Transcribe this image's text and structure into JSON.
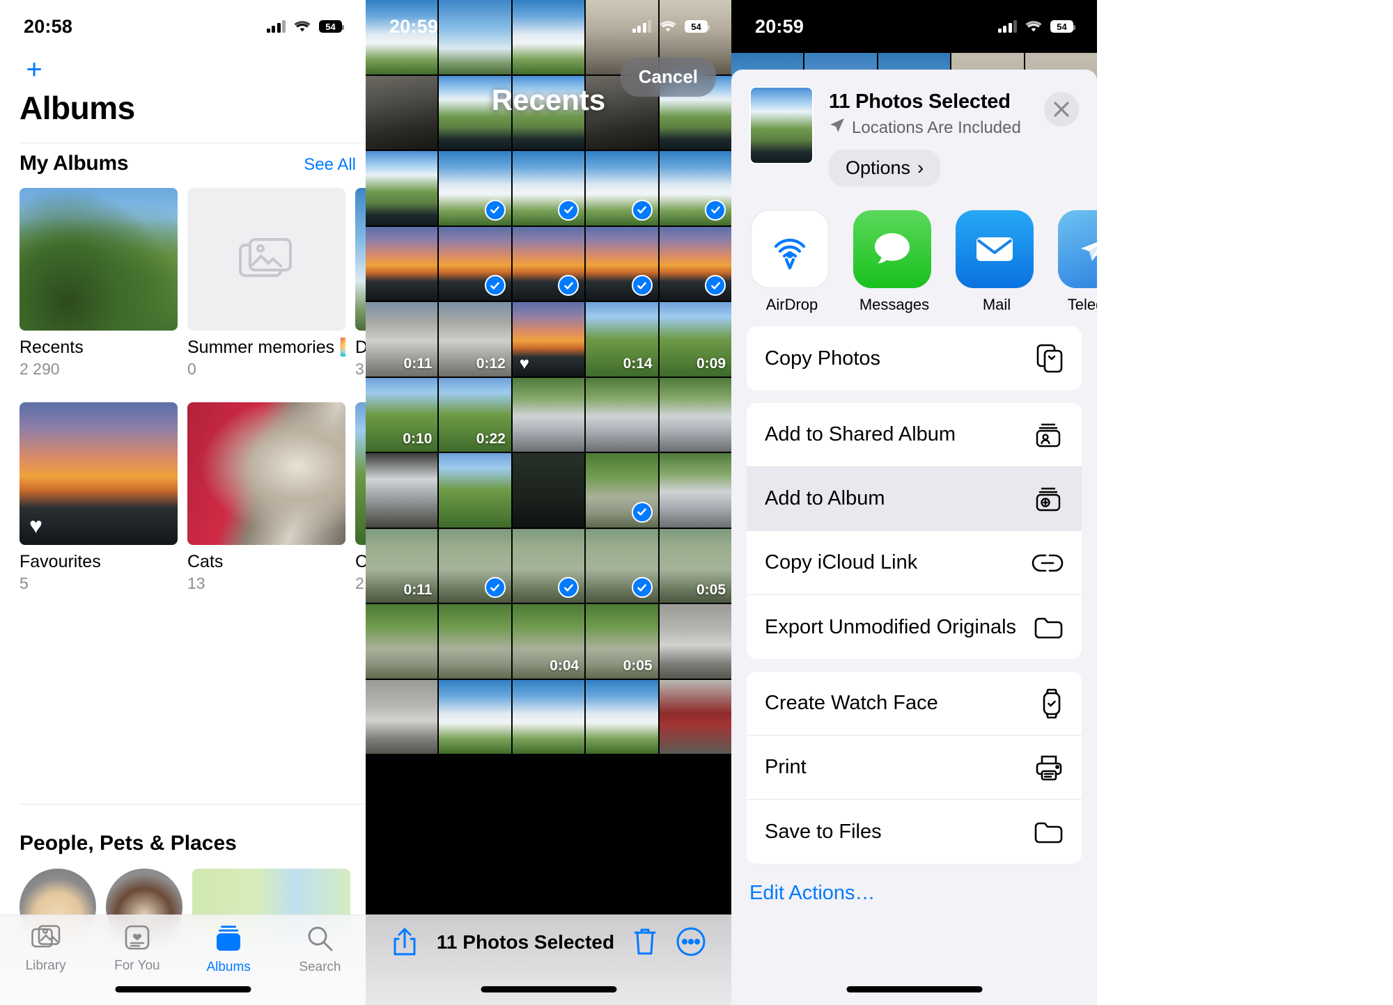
{
  "panel_albums": {
    "status": {
      "time": "20:58",
      "battery": "54"
    },
    "add_button": "+",
    "title": "Albums",
    "section": {
      "heading": "My Albums",
      "see_all": "See All"
    },
    "albums": [
      {
        "name": "Recents",
        "count": "2 290",
        "art": "img-trees",
        "favourite": false
      },
      {
        "name": "Summer memories 🌅",
        "count": "0",
        "art": "placeholder",
        "favourite": false
      },
      {
        "name": "D",
        "count": "3",
        "art": "img-sky",
        "favourite": false
      },
      {
        "name": "Favourites",
        "count": "5",
        "art": "img-sunset",
        "favourite": true
      },
      {
        "name": "Cats",
        "count": "13",
        "art": "img-cat",
        "favourite": false
      },
      {
        "name": "C",
        "count": "2",
        "art": "img-green",
        "favourite": false
      }
    ],
    "people_heading": "People, Pets & Places",
    "tabs": [
      {
        "label": "Library",
        "icon": "photos-library-icon",
        "active": false
      },
      {
        "label": "For You",
        "icon": "for-you-icon",
        "active": false
      },
      {
        "label": "Albums",
        "icon": "albums-icon",
        "active": true
      },
      {
        "label": "Search",
        "icon": "search-icon",
        "active": false
      }
    ]
  },
  "panel_recents": {
    "status": {
      "time": "20:59",
      "battery": "54"
    },
    "title": "Recents",
    "cancel": "Cancel",
    "toolbar": {
      "share_icon": "share-icon",
      "count_label": "11 Photos Selected",
      "trash_icon": "trash-icon",
      "more_icon": "more-circle-icon"
    },
    "grid": [
      {
        "art": "img-clouds",
        "dur": "",
        "sel": false,
        "fav": false
      },
      {
        "art": "img-sky",
        "dur": "",
        "sel": false,
        "fav": false
      },
      {
        "art": "img-clouds",
        "dur": "",
        "sel": false,
        "fav": false
      },
      {
        "art": "img-store",
        "dur": "",
        "sel": false,
        "fav": false
      },
      {
        "art": "img-store",
        "dur": "",
        "sel": false,
        "fav": false
      },
      {
        "art": "img-interior",
        "dur": "",
        "sel": false,
        "fav": false
      },
      {
        "art": "img-road",
        "dur": "",
        "sel": false,
        "fav": false
      },
      {
        "art": "img-road",
        "dur": "",
        "sel": false,
        "fav": false
      },
      {
        "art": "img-interior",
        "dur": "",
        "sel": false,
        "fav": false
      },
      {
        "art": "img-road",
        "dur": "",
        "sel": false,
        "fav": false
      },
      {
        "art": "img-road",
        "dur": "",
        "sel": false,
        "fav": false
      },
      {
        "art": "img-clouds",
        "dur": "",
        "sel": true,
        "fav": false
      },
      {
        "art": "img-clouds",
        "dur": "",
        "sel": true,
        "fav": false
      },
      {
        "art": "img-clouds",
        "dur": "",
        "sel": true,
        "fav": false
      },
      {
        "art": "img-clouds",
        "dur": "",
        "sel": true,
        "fav": false
      },
      {
        "art": "img-sunset",
        "dur": "",
        "sel": false,
        "fav": false
      },
      {
        "art": "img-sunset",
        "dur": "",
        "sel": true,
        "fav": false
      },
      {
        "art": "img-sunset",
        "dur": "",
        "sel": true,
        "fav": false
      },
      {
        "art": "img-sunset",
        "dur": "",
        "sel": true,
        "fav": false
      },
      {
        "art": "img-sunset",
        "dur": "",
        "sel": true,
        "fav": false
      },
      {
        "art": "img-parking",
        "dur": "0:11",
        "sel": false,
        "fav": false
      },
      {
        "art": "img-parking",
        "dur": "0:12",
        "sel": false,
        "fav": false
      },
      {
        "art": "img-sunset",
        "dur": "",
        "sel": false,
        "fav": true
      },
      {
        "art": "img-green",
        "dur": "0:14",
        "sel": false,
        "fav": false
      },
      {
        "art": "img-green",
        "dur": "0:09",
        "sel": false,
        "fav": false
      },
      {
        "art": "img-green",
        "dur": "0:10",
        "sel": false,
        "fav": false
      },
      {
        "art": "img-green",
        "dur": "0:22",
        "sel": false,
        "fav": false
      },
      {
        "art": "img-car",
        "dur": "",
        "sel": false,
        "fav": false
      },
      {
        "art": "img-car",
        "dur": "",
        "sel": false,
        "fav": false
      },
      {
        "art": "img-car",
        "dur": "",
        "sel": false,
        "fav": false
      },
      {
        "art": "img-laptop",
        "dur": "",
        "sel": false,
        "fav": false
      },
      {
        "art": "img-green",
        "dur": "",
        "sel": false,
        "fav": false
      },
      {
        "art": "img-dark",
        "dur": "",
        "sel": false,
        "fav": false
      },
      {
        "art": "img-path",
        "dur": "",
        "sel": true,
        "fav": false
      },
      {
        "art": "img-car",
        "dur": "",
        "sel": false,
        "fav": false
      },
      {
        "art": "img-water",
        "dur": "0:11",
        "sel": false,
        "fav": false
      },
      {
        "art": "img-water",
        "dur": "",
        "sel": true,
        "fav": false
      },
      {
        "art": "img-water",
        "dur": "",
        "sel": true,
        "fav": false
      },
      {
        "art": "img-water",
        "dur": "",
        "sel": true,
        "fav": false
      },
      {
        "art": "img-water",
        "dur": "0:05",
        "sel": false,
        "fav": false
      },
      {
        "art": "img-path",
        "dur": "",
        "sel": false,
        "fav": false
      },
      {
        "art": "img-path",
        "dur": "",
        "sel": false,
        "fav": false
      },
      {
        "art": "img-path",
        "dur": "0:04",
        "sel": false,
        "fav": false
      },
      {
        "art": "img-path",
        "dur": "0:05",
        "sel": false,
        "fav": false
      },
      {
        "art": "img-garage",
        "dur": "",
        "sel": false,
        "fav": false
      },
      {
        "art": "img-garage",
        "dur": "",
        "sel": false,
        "fav": false
      },
      {
        "art": "img-clouds",
        "dur": "",
        "sel": false,
        "fav": false
      },
      {
        "art": "img-clouds",
        "dur": "",
        "sel": false,
        "fav": false
      },
      {
        "art": "img-clouds",
        "dur": "",
        "sel": false,
        "fav": false
      },
      {
        "art": "img-redcar",
        "dur": "",
        "sel": false,
        "fav": false
      }
    ]
  },
  "panel_share": {
    "status": {
      "time": "20:59",
      "battery": "54"
    },
    "header": {
      "title": "11 Photos Selected",
      "subtitle": "Locations Are Included",
      "options_label": "Options",
      "options_chevron": "›",
      "close_icon": "close-icon",
      "location_icon": "location-arrow-icon"
    },
    "apps": [
      {
        "label": "AirDrop",
        "icon": "airdrop-icon"
      },
      {
        "label": "Messages",
        "icon": "messages-icon"
      },
      {
        "label": "Mail",
        "icon": "mail-icon"
      },
      {
        "label": "Telegram",
        "icon": "telegram-icon"
      },
      {
        "label": "",
        "icon": "notes-icon"
      }
    ],
    "groups": [
      {
        "rows": [
          {
            "label": "Copy Photos",
            "icon": "copy-icon",
            "highlighted": false
          }
        ]
      },
      {
        "rows": [
          {
            "label": "Add to Shared Album",
            "icon": "shared-album-icon",
            "highlighted": false
          },
          {
            "label": "Add to Album",
            "icon": "add-album-icon",
            "highlighted": true
          },
          {
            "label": "Copy iCloud Link",
            "icon": "link-icon",
            "highlighted": false
          },
          {
            "label": "Export Unmodified Originals",
            "icon": "folder-icon",
            "highlighted": false
          }
        ]
      },
      {
        "rows": [
          {
            "label": "Create Watch Face",
            "icon": "watch-icon",
            "highlighted": false
          },
          {
            "label": "Print",
            "icon": "printer-icon",
            "highlighted": false
          },
          {
            "label": "Save to Files",
            "icon": "folder-icon",
            "highlighted": false
          }
        ]
      }
    ],
    "edit_actions": "Edit Actions…"
  },
  "colors": {
    "accent": "#007aff",
    "sheet_bg": "#f2f2f7",
    "highlight": "#e8e8ef",
    "secondary_text": "#8e8e93"
  }
}
